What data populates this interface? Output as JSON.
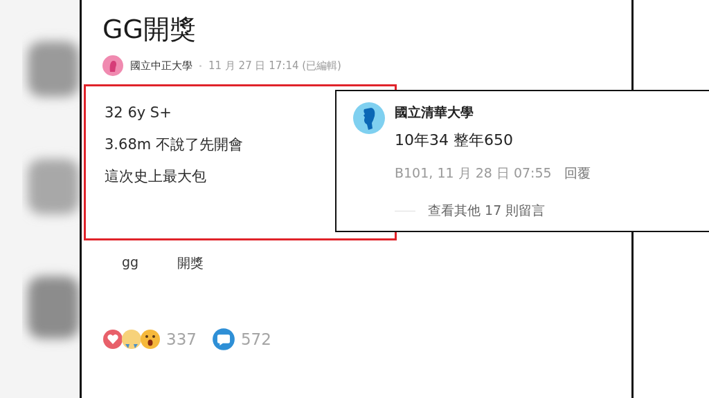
{
  "post": {
    "title": "GG開獎",
    "author": "國立中正大學",
    "meta": "11 月 27 日 17:14 (已編輯)",
    "body": [
      "32 6y S+",
      "3.68m 不說了先開會",
      "這次史上最大包"
    ],
    "highlighted": true,
    "tags": [
      "gg",
      "開獎"
    ],
    "reaction_count": "337",
    "comment_count": "572"
  },
  "comment": {
    "author": "國立清華大學",
    "text": "10年34 整年650",
    "meta": "B101, 11 月 28 日 07:55",
    "reply": "回覆",
    "more": "查看其他 17 則留言"
  }
}
